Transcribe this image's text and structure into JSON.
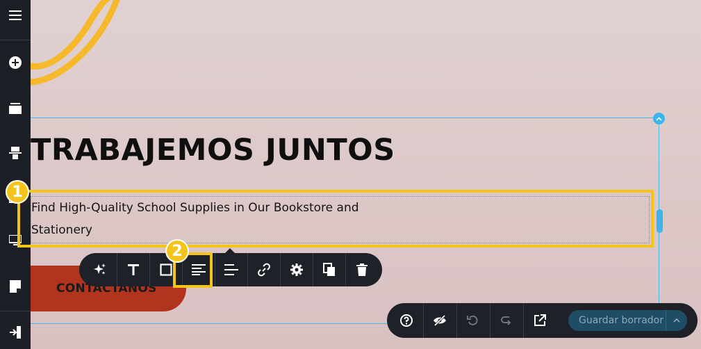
{
  "sidebar": {
    "items": [
      {
        "name": "menu-icon"
      },
      {
        "name": "add-icon"
      },
      {
        "name": "sections-icon"
      },
      {
        "name": "layout-icon"
      },
      {
        "name": "media-icon"
      },
      {
        "name": "preview-desktop-icon"
      },
      {
        "name": "pages-icon"
      },
      {
        "name": "exit-icon"
      }
    ]
  },
  "content": {
    "heading": "TRABAJEMOS JUNTOS",
    "subtitle": "Find High-Quality School Supplies in Our Bookstore and Stationery",
    "cta_label": "CONTÁCTANOS"
  },
  "annotations": {
    "badge1": "1",
    "badge2": "2"
  },
  "toolbar": {
    "buttons": [
      "ai-magic-icon",
      "text-type-icon",
      "border-box-icon",
      "align-left-icon",
      "align-options-icon",
      "link-icon",
      "settings-gear-icon",
      "duplicate-icon",
      "delete-icon"
    ]
  },
  "bottombar": {
    "buttons": [
      "help-icon",
      "hide-eye-icon",
      "undo-icon",
      "redo-icon",
      "open-external-icon"
    ],
    "save_label": "Guardar borrador"
  },
  "colors": {
    "accent": "#3bb5ea",
    "highlight": "#f3c51a",
    "cta_bg": "#b2341f",
    "dark_ui": "#1e2128",
    "save_bg": "#1f4d66"
  }
}
